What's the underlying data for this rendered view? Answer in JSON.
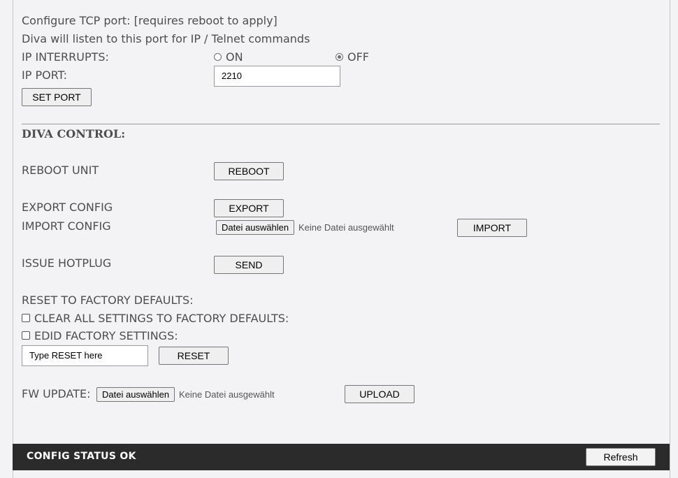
{
  "tcp": {
    "line1": "Configure TCP port: [requires reboot to apply]",
    "line2": "Diva will listen to this port for IP / Telnet commands",
    "interrupts_label": "IP INTERRUPTS:",
    "on_label": "ON",
    "off_label": "OFF",
    "selected": "OFF",
    "port_label": "IP PORT:",
    "port_value": "2210",
    "set_port_button": "SET PORT"
  },
  "control": {
    "heading": "DIVA CONTROL:",
    "reboot_label": "REBOOT UNIT",
    "reboot_button": "REBOOT",
    "export_label": "EXPORT CONFIG",
    "export_button": "EXPORT",
    "import_label": "IMPORT CONFIG",
    "import_file_button": "Datei auswählen",
    "import_file_status": "Keine Datei ausgewählt",
    "import_button": "IMPORT",
    "hotplug_label": "ISSUE HOTPLUG",
    "hotplug_button": "SEND"
  },
  "reset": {
    "heading": "RESET TO FACTORY DEFAULTS:",
    "clear_all_label": "CLEAR ALL SETTINGS TO FACTORY DEFAULTS:",
    "edid_label": "EDID FACTORY SETTINGS:",
    "input_value": "Type RESET here",
    "reset_button": "RESET"
  },
  "fw": {
    "label": "FW UPDATE:",
    "file_button": "Datei auswählen",
    "file_status": "Keine Datei ausgewählt",
    "upload_button": "UPLOAD"
  },
  "footer": {
    "status": "CONFIG STATUS OK",
    "refresh_button": "Refresh"
  }
}
